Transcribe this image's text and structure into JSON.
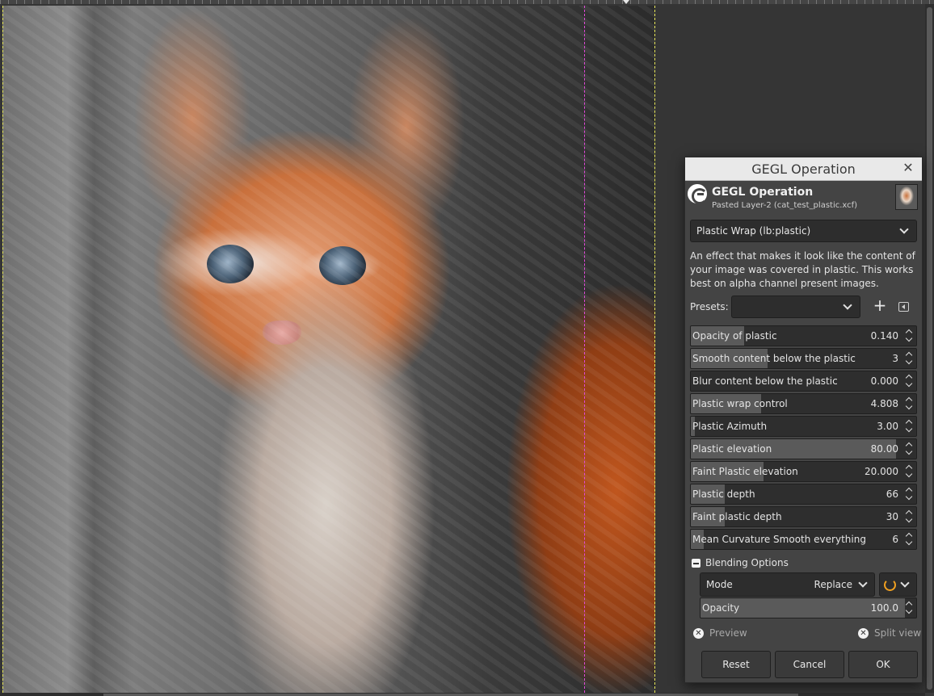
{
  "dialog": {
    "window_title": "GEGL Operation",
    "header_title": "GEGL Operation",
    "header_subtitle": "Pasted Layer-2 (cat_test_plastic.xcf)",
    "operation": "Plastic Wrap (lb:plastic)",
    "description": "An effect that makes it look like the content of your image was covered in plastic. This works best on alpha channel present images.",
    "presets_label": "Presets:",
    "presets_value": "",
    "parameters": [
      {
        "label": "Opacity of plastic",
        "value": "0.140",
        "fill": 0.25
      },
      {
        "label": "Smooth content below the plastic",
        "value": "3",
        "fill": 0.36
      },
      {
        "label": "Blur content below the plastic",
        "value": "0.000",
        "fill": 0.0
      },
      {
        "label": "Plastic wrap control",
        "value": "4.808",
        "fill": 0.33
      },
      {
        "label": "Plastic Azimuth",
        "value": "3.00",
        "fill": 0.02
      },
      {
        "label": "Plastic elevation",
        "value": "80.00",
        "fill": 0.96
      },
      {
        "label": "Faint Plastic elevation",
        "value": "20.000",
        "fill": 0.34
      },
      {
        "label": "Plastic depth",
        "value": "66",
        "fill": 0.16
      },
      {
        "label": "Faint plastic depth",
        "value": "30",
        "fill": 0.16
      },
      {
        "label": "Mean Curvature Smooth everything",
        "value": "6",
        "fill": 0.06
      }
    ],
    "blending": {
      "section_label": "Blending Options",
      "mode_label": "Mode",
      "mode_value": "Replace",
      "opacity_label": "Opacity",
      "opacity_value": "100.0",
      "opacity_fill": 1.0
    },
    "preview_label": "Preview",
    "splitview_label": "Split view",
    "buttons": {
      "reset": "Reset",
      "cancel": "Cancel",
      "ok": "OK"
    }
  },
  "colors": {
    "selection_marching_ants": "#e8e85a",
    "layer_boundary": "#e04ad8",
    "mode_switch_accent": "#f0a020"
  }
}
